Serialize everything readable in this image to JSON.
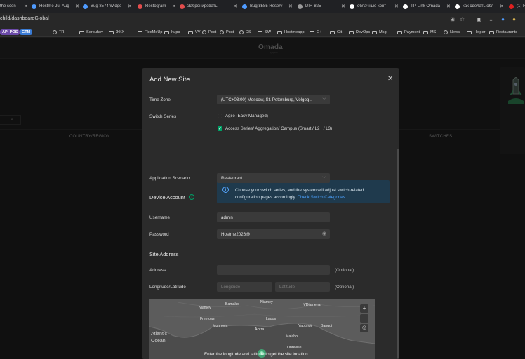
{
  "browser": {
    "tabs": [
      {
        "title": "the scen",
        "icon": "doc-icon",
        "color": "#8d8d8d"
      },
      {
        "title": "Hostme Jul-Aug",
        "icon": "azure-icon",
        "color": "#4f9bff"
      },
      {
        "title": "Bug 8574 Widge",
        "icon": "azure-icon",
        "color": "#4f9bff"
      },
      {
        "title": "Restogram",
        "icon": "restogram-icon",
        "color": "#e44d4d"
      },
      {
        "title": "Забронировать",
        "icon": "restogram-icon",
        "color": "#e44d4d"
      },
      {
        "title": "Bug 8585 Reserv",
        "icon": "azure-icon",
        "color": "#4f9bff"
      },
      {
        "title": "DIR-825",
        "icon": "globe-icon",
        "color": "#9a9a9a"
      },
      {
        "title": "облачные конт",
        "icon": "google-icon",
        "color": "#ffffff"
      },
      {
        "title": "TP-Link Omada",
        "icon": "google-icon",
        "color": "#ffffff"
      },
      {
        "title": "как сделать обл",
        "icon": "google-icon",
        "color": "#ffffff"
      },
      {
        "title": "(1) H",
        "icon": "youtube-icon",
        "color": "#e02020"
      }
    ],
    "url": "child/dashboardGlobal",
    "bookmarks": [
      {
        "label": "API POS",
        "type": "badge",
        "color": "#6b4aa8"
      },
      {
        "label": "GTM",
        "type": "badge",
        "color": "#3a7bd5"
      },
      {
        "label": "TR",
        "type": "icon"
      },
      {
        "label": "Serpuhov",
        "type": "folder"
      },
      {
        "label": "ЖКХ",
        "type": "folder"
      },
      {
        "label": "FlexMeUp",
        "type": "folder"
      },
      {
        "label": "Кира",
        "type": "folder"
      },
      {
        "label": "VV",
        "type": "folder"
      },
      {
        "label": "Post",
        "type": "icon"
      },
      {
        "label": "Post",
        "type": "icon"
      },
      {
        "label": "DS",
        "type": "icon"
      },
      {
        "label": "SW",
        "type": "folder"
      },
      {
        "label": "Hostmeapp",
        "type": "folder"
      },
      {
        "label": "G+",
        "type": "folder"
      },
      {
        "label": "Git",
        "type": "folder"
      },
      {
        "label": "DevOps",
        "type": "folder"
      },
      {
        "label": "Msg",
        "type": "folder"
      },
      {
        "label": "Payment",
        "type": "folder"
      },
      {
        "label": "MS",
        "type": "folder"
      },
      {
        "label": "News",
        "type": "icon"
      },
      {
        "label": "Helper",
        "type": "folder"
      },
      {
        "label": "Restaurants",
        "type": "folder"
      }
    ]
  },
  "app": {
    "brand": "Omada",
    "brand_sub": "by tp-link",
    "columns": {
      "country": "COUNTRY/REGION",
      "switches": "SWITCHES"
    }
  },
  "modal": {
    "title": "Add New Site",
    "time_zone": {
      "label": "Time Zone",
      "value": "(UTC+03:00) Moscow, St. Petersburg, Volgog..."
    },
    "switch_series": {
      "label": "Switch Series",
      "options": [
        {
          "label": "Agile (Easy Managed)",
          "checked": false
        },
        {
          "label": "Access Series/ Aggregation/ Campus (Smart / L2+ / L3)",
          "checked": true
        }
      ]
    },
    "info": {
      "text": "Choose your switch series, and the system will adjust switch-related configuration pages accordingly.",
      "link": "Check Switch Categories"
    },
    "application_scenario": {
      "label": "Application Scenario",
      "value": "Restaurant"
    },
    "device_account": {
      "title": "Device Account",
      "info_icon": "info-circle-icon"
    },
    "username": {
      "label": "Username",
      "value": "admin"
    },
    "password": {
      "label": "Password",
      "value": "Hostme2026@"
    },
    "site_address": {
      "title": "Site Address"
    },
    "address": {
      "label": "Address",
      "value": "",
      "optional": "(Optional)"
    },
    "lon_lat": {
      "label": "Longitude/Latitude",
      "longitude_placeholder": "Longitude",
      "latitude_placeholder": "Latitude",
      "optional": "(Optional)"
    },
    "map": {
      "places": [
        "Bamako",
        "Niamey",
        "N'Djamena",
        "Bissau",
        "Freetown",
        "Monrovia",
        "Accra",
        "Lagos",
        "Malabo",
        "Libreville",
        "Bangui",
        "Yaoundé",
        "Atlantic Ocean"
      ],
      "hint": "Enter the longitude and latitude to get the site location."
    }
  }
}
